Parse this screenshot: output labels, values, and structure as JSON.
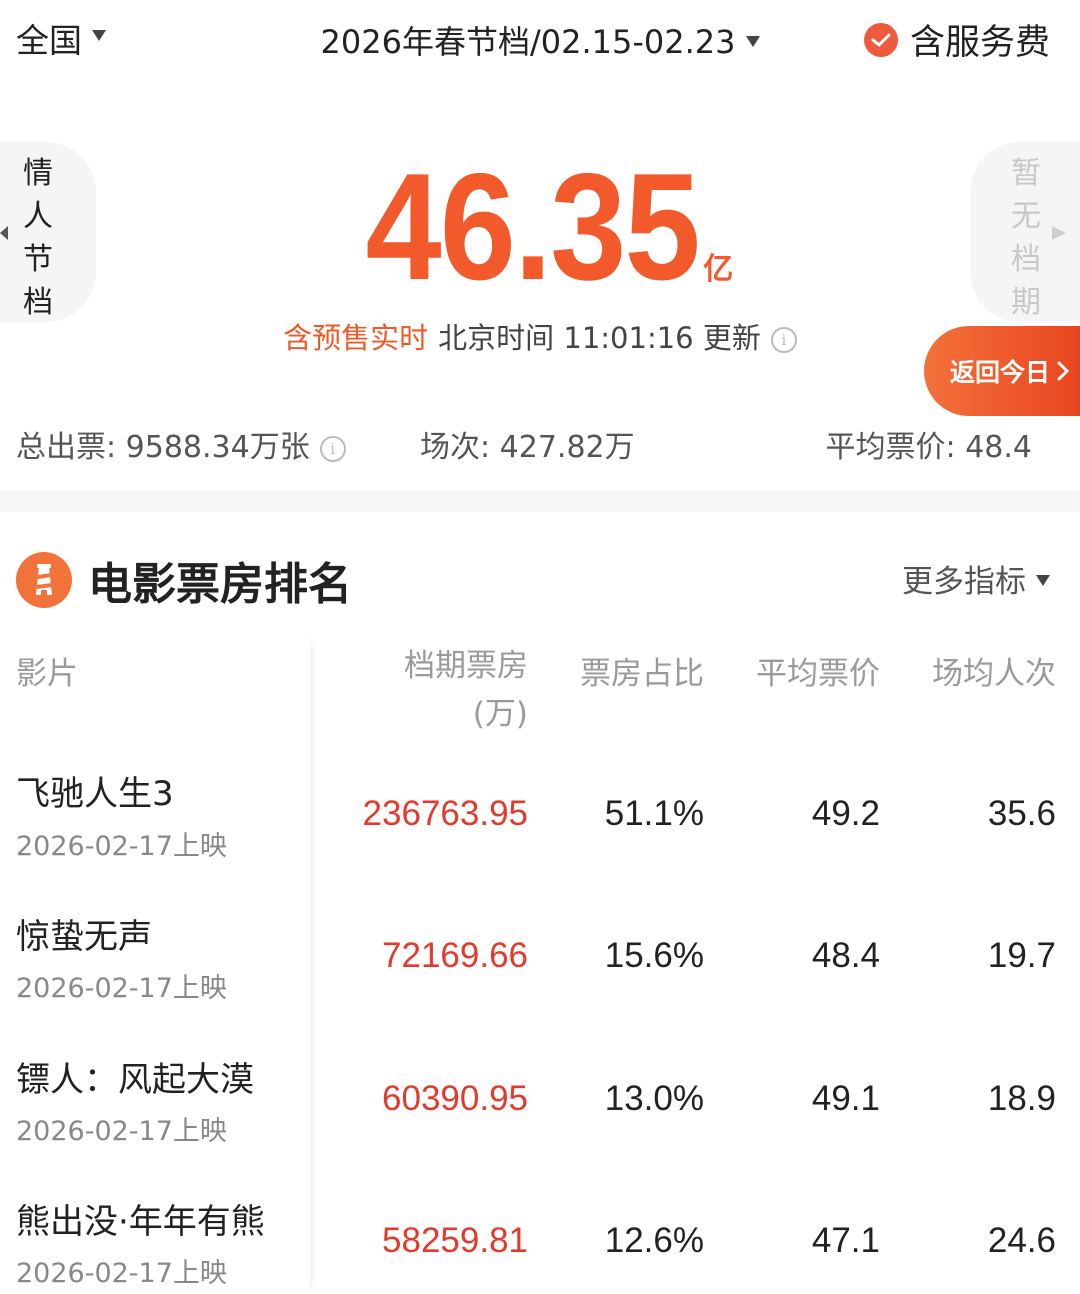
{
  "header": {
    "region": "全国",
    "period": "2026年春节档/02.15-02.23",
    "service_label": "含服务费"
  },
  "hero": {
    "prev_period": "情人节档",
    "next_period": "暂无档期",
    "total_value": "46.35",
    "total_unit": "亿",
    "update_highlight": "含预售实时",
    "update_text": "北京时间 11:01:16 更新",
    "back_today_label": "返回今日"
  },
  "stats": {
    "tickets": "总出票: 9588.34万张",
    "shows": "场次: 427.82万",
    "avg_price": "平均票价: 48.4"
  },
  "ranking": {
    "title": "电影票房排名",
    "more_label": "更多指标",
    "headers": {
      "film": "影片",
      "box_office": "档期票房",
      "box_office_unit": "(万)",
      "share": "票房占比",
      "avg_price": "平均票价",
      "avg_audience": "场均人次"
    },
    "rows": [
      {
        "name": "飞驰人生3",
        "date": "2026-02-17上映",
        "box": "236763.95",
        "share": "51.1%",
        "price": "49.2",
        "audience": "35.6"
      },
      {
        "name": "惊蛰无声",
        "date": "2026-02-17上映",
        "box": "72169.66",
        "share": "15.6%",
        "price": "48.4",
        "audience": "19.7"
      },
      {
        "name": "镖人：风起大漠",
        "date": "2026-02-17上映",
        "box": "60390.95",
        "share": "13.0%",
        "price": "49.1",
        "audience": "18.9"
      },
      {
        "name": "熊出没·年年有熊",
        "date": "2026-02-17上映",
        "box": "58259.81",
        "share": "12.6%",
        "price": "47.1",
        "audience": "24.6"
      }
    ]
  },
  "colors": {
    "accent": "#f25a2c",
    "box_office_red": "#e5392b"
  }
}
